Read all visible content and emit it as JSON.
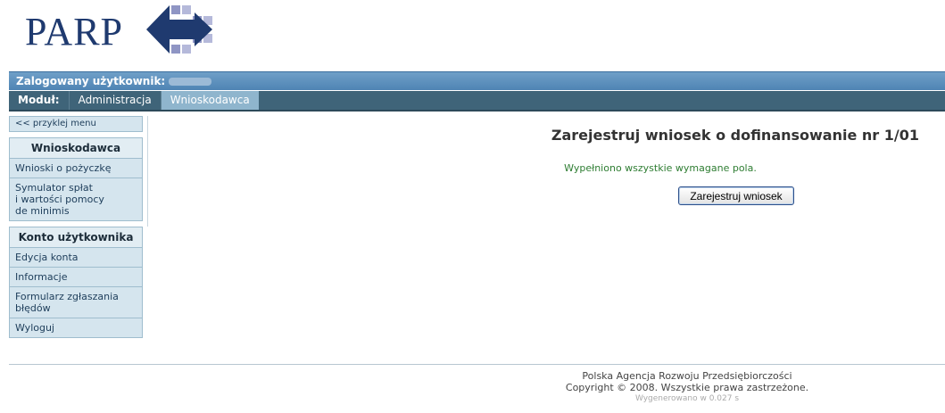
{
  "logo": {
    "text": "PARP",
    "icon": "parp-arrows-logo-icon"
  },
  "userbar": {
    "label": "Zalogowany użytkownik:"
  },
  "modbar": {
    "label": "Moduł:",
    "tabs": [
      {
        "label": "Administracja",
        "active": false
      },
      {
        "label": "Wnioskodawca",
        "active": true
      }
    ]
  },
  "sidebar": {
    "stick_label": "<< przyklej menu",
    "sections": [
      {
        "title": "Wnioskodawca",
        "items": [
          "Wnioski o pożyczkę",
          "Symulator spłat\ni wartości pomocy\nde minimis"
        ]
      },
      {
        "title": "Konto użytkownika",
        "items": [
          "Edycja konta",
          "Informacje",
          "Formularz zgłaszania\nbłędów",
          "Wyloguj"
        ]
      }
    ]
  },
  "main": {
    "title": "Zarejestruj wniosek o dofinansowanie nr 1/01",
    "status": "Wypełniono wszystkie wymagane pola.",
    "register_button": "Zarejestruj wniosek"
  },
  "footer": {
    "org": "Polska Agencja Rozwoju Przedsiębiorczości",
    "copyright": "Copyright © 2008. Wszystkie prawa zastrzeżone.",
    "generated": "Wygenerowano w 0.027 s"
  },
  "colors": {
    "brand": "#1f3a6f",
    "userbar": "#5a8fbd",
    "modbar": "#3f6479",
    "status": "#2e7d32"
  }
}
